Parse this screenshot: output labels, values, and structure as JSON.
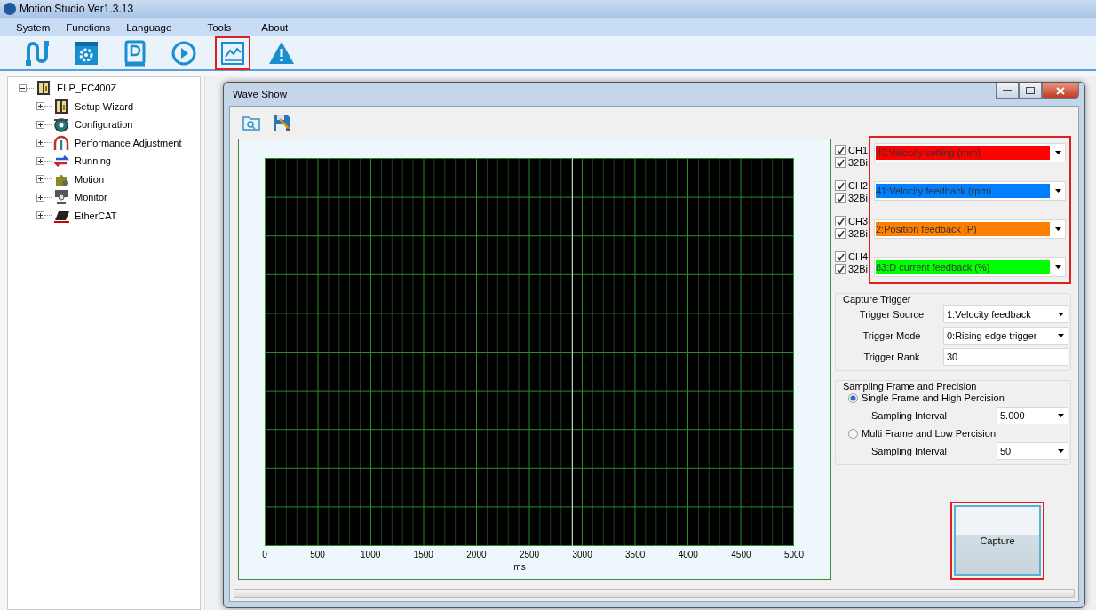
{
  "window": {
    "title": "Motion Studio  Ver1.3.13"
  },
  "menu": [
    "System",
    "Functions",
    "Language",
    "Tools",
    "About"
  ],
  "toolbar": [
    {
      "kind": "cable",
      "highlighted": false
    },
    {
      "kind": "gear",
      "highlighted": false
    },
    {
      "kind": "book",
      "highlighted": false
    },
    {
      "kind": "play",
      "highlighted": false
    },
    {
      "kind": "chart",
      "highlighted": true
    },
    {
      "kind": "warning",
      "highlighted": false
    }
  ],
  "tree": [
    {
      "label": "ELP_EC400Z",
      "kind": "drive",
      "expanded": true,
      "children": [
        {
          "label": "Setup Wizard",
          "kind": "drive",
          "expanded": false
        },
        {
          "label": "Configuration",
          "kind": "gear",
          "expanded": false
        },
        {
          "label": "Performance Adjustment",
          "kind": "gauge",
          "expanded": false
        },
        {
          "label": "Running",
          "kind": "cycle",
          "expanded": false
        },
        {
          "label": "Motion",
          "kind": "puzzle",
          "expanded": false
        },
        {
          "label": "Monitor",
          "kind": "monitor",
          "expanded": false
        },
        {
          "label": "EtherCAT",
          "kind": "ecat",
          "expanded": false
        }
      ]
    }
  ],
  "wave_window": {
    "title": "Wave Show",
    "plot": {
      "x_tick_labels": [
        "0",
        "500",
        "1000",
        "1500",
        "2000",
        "2500",
        "3000",
        "3500",
        "4000",
        "4500",
        "5000"
      ],
      "x_unit": "ms"
    },
    "channels_highlighted": true,
    "channels": [
      {
        "label": "CH1",
        "checked": true,
        "bit_label": "32Bi",
        "bit_checked": true,
        "value": "40:Velocity setting (rpm)",
        "color": "#ff0000"
      },
      {
        "label": "CH2",
        "checked": true,
        "bit_label": "32Bi",
        "bit_checked": true,
        "value": "41:Velocity feedback (rpm)",
        "color": "#0080ff"
      },
      {
        "label": "CH3",
        "checked": true,
        "bit_label": "32Bi",
        "bit_checked": true,
        "value": "2:Position feedback (P)",
        "color": "#ff8000"
      },
      {
        "label": "CH4",
        "checked": true,
        "bit_label": "32Bi",
        "bit_checked": true,
        "value": "83:D current feedback (%)",
        "color": "#00ff00"
      }
    ],
    "capture_trigger": {
      "title": "Capture Trigger",
      "fields": [
        {
          "label": "Trigger Source",
          "kind": "dropdown",
          "value": "1:Velocity feedback"
        },
        {
          "label": "Trigger Mode",
          "kind": "dropdown",
          "value": "0:Rising edge trigger"
        },
        {
          "label": "Trigger Rank",
          "kind": "text",
          "value": "30"
        }
      ]
    },
    "sampling": {
      "title": "Sampling Frame and Precision",
      "options": [
        {
          "label": "Single Frame and High Percision",
          "selected": true,
          "interval_label": "Sampling Interval",
          "interval": "5.000"
        },
        {
          "label": "Multi Frame and Low Percision",
          "selected": false,
          "interval_label": "Sampling Interval",
          "interval": "50"
        }
      ]
    },
    "capture_button": {
      "label": "Capture",
      "highlighted": true
    }
  }
}
